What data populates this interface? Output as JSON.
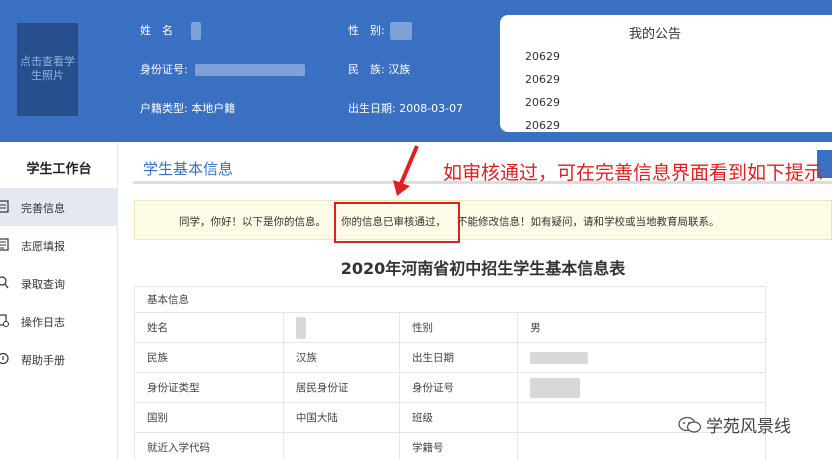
{
  "header": {
    "photo_label": "点击查看学生照片",
    "name_label": "姓　名",
    "gender_label": "性　别:",
    "id_label": "身份证号:",
    "ethnic_label": "民　族:",
    "ethnic_value": "汉族",
    "hukou_label": "户籍类型:",
    "hukou_value": "本地户籍",
    "birth_label": "出生日期:",
    "birth_value": "2008-03-07"
  },
  "notice": {
    "title": "我的公告",
    "items": [
      "20629",
      "20629",
      "20629",
      "20629"
    ]
  },
  "sidebar": {
    "title": "学生工作台",
    "items": [
      {
        "label": "完善信息",
        "icon": "edit-icon"
      },
      {
        "label": "志愿填报",
        "icon": "form-icon"
      },
      {
        "label": "录取查询",
        "icon": "search-icon"
      },
      {
        "label": "操作日志",
        "icon": "log-icon"
      },
      {
        "label": "帮助手册",
        "icon": "help-icon"
      }
    ]
  },
  "main": {
    "title": "学生基本信息",
    "info_part1": "同学，你好！以下是你的信息。",
    "info_highlight": "你的信息已审核通过，",
    "info_part2": "不能修改信息！如有疑问，请和学校或当地教育局联系。",
    "annotation": "如审核通过，可在完善信息界面看到如下提示",
    "form_title": "2020年河南省初中招生学生基本信息表"
  },
  "table": {
    "section": "基本信息",
    "name_label": "姓名",
    "gender_label": "性别",
    "gender_value": "男",
    "ethnic_label": "民族",
    "ethnic_value": "汉族",
    "birth_label": "出生日期",
    "idtype_label": "身份证类型",
    "idtype_value": "居民身份证",
    "idno_label": "身份证号",
    "country_label": "国别",
    "country_value": "中国大陆",
    "class_label": "班级",
    "school_label": "就近入学代码",
    "studentno_label": "学籍号"
  },
  "watermark": "学苑风景线",
  "colors": {
    "header_blue": "#3a70c2",
    "annotation_red": "#e02020",
    "info_bar_bg": "#fdfbe5"
  }
}
